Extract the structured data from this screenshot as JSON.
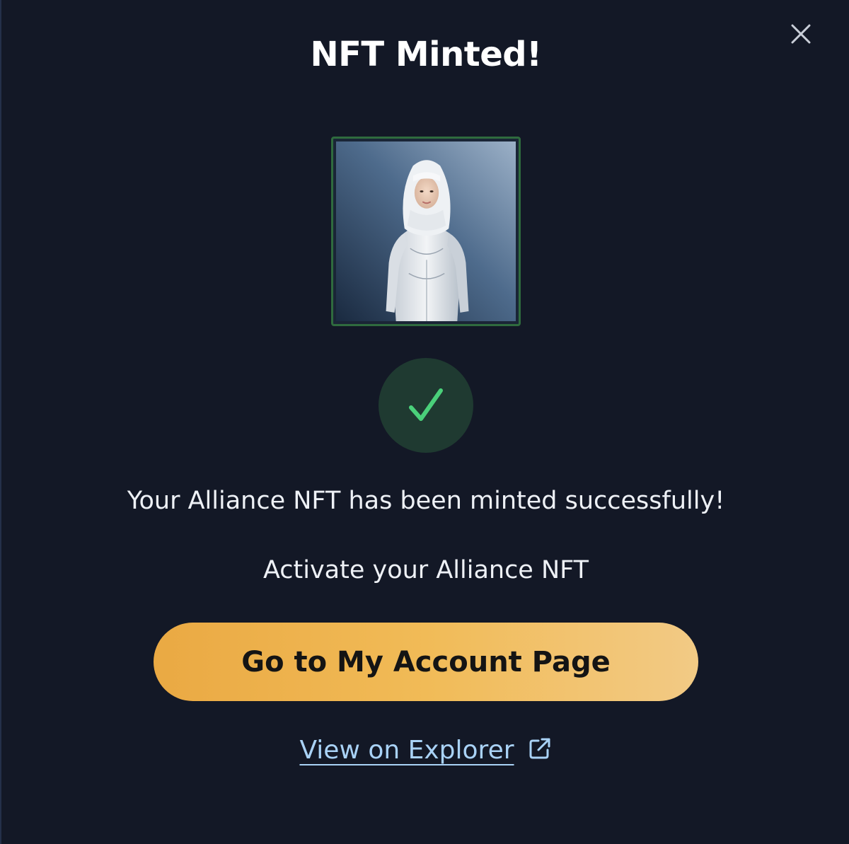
{
  "modal": {
    "title": "NFT Minted!",
    "close_icon": "close-icon",
    "success_icon": "checkmark-icon",
    "success_message": "Your Alliance NFT has been minted successfully!",
    "activate_message": "Activate your Alliance NFT",
    "primary_button_label": "Go to My Account Page",
    "explorer_link_label": "View on Explorer",
    "explorer_link_icon": "external-link-icon"
  },
  "colors": {
    "background": "#131826",
    "accent_gold": "#f1bb57",
    "success_green": "#4ad07a",
    "link_blue": "#a9d2f6"
  }
}
